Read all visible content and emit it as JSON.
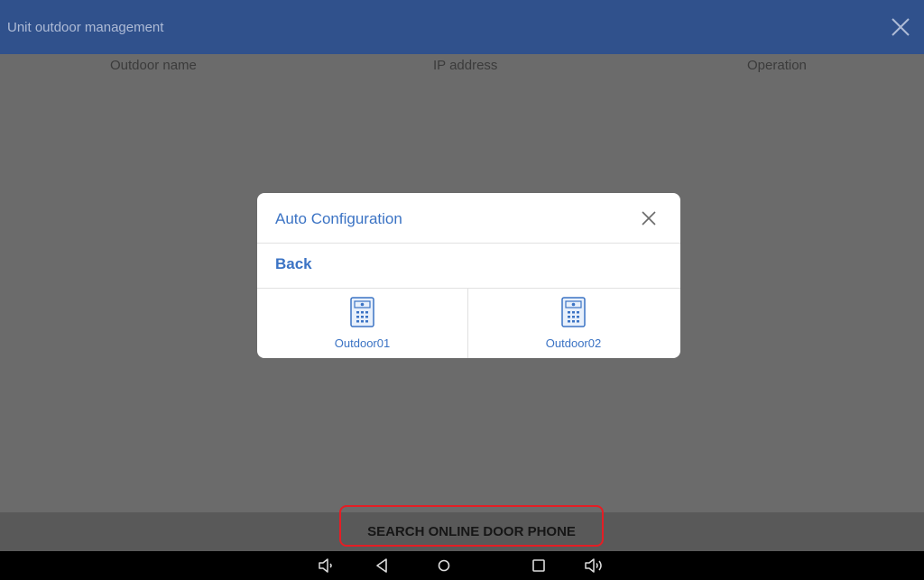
{
  "header": {
    "title": "Unit outdoor management",
    "close_icon": "close-icon"
  },
  "table": {
    "columns": [
      "Outdoor name",
      "IP address",
      "Operation"
    ]
  },
  "dialog": {
    "title": "Auto Configuration",
    "back_label": "Back",
    "devices": [
      {
        "name": "Outdoor01",
        "icon": "door-phone-icon"
      },
      {
        "name": "Outdoor02",
        "icon": "door-phone-icon"
      }
    ]
  },
  "footer": {
    "search_button": "SEARCH ONLINE DOOR PHONE"
  },
  "navbar": {
    "icons": [
      "volume-down-icon",
      "back-icon",
      "home-icon",
      "recent-apps-icon",
      "volume-up-icon"
    ]
  },
  "colors": {
    "header_bg": "#30518c",
    "accent": "#3b73c4",
    "highlight": "#e41e25"
  }
}
